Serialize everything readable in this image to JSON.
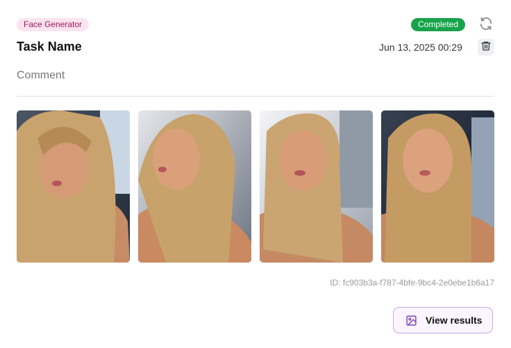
{
  "task": {
    "tag": "Face Generator",
    "status": "Completed",
    "name": "Task Name",
    "date": "Jun 13, 2025 00:29",
    "comment": "Comment",
    "id_text": "ID: fc903b3a-f787-4bfe-9bc4-2e0ebe1b6a17"
  },
  "colors": {
    "tag_bg": "#fbe4ef",
    "tag_text": "#a0195a",
    "status_bg": "#16a34a",
    "accent_border": "#c9a7e6"
  },
  "icons": {
    "refresh": "refresh-icon",
    "trash": "trash-icon",
    "image": "image-icon"
  },
  "actions": {
    "view_results": "View results"
  },
  "gallery": {
    "images": [
      {
        "alt": "Generated face 1"
      },
      {
        "alt": "Generated face 2"
      },
      {
        "alt": "Generated face 3"
      },
      {
        "alt": "Generated face 4"
      }
    ]
  }
}
